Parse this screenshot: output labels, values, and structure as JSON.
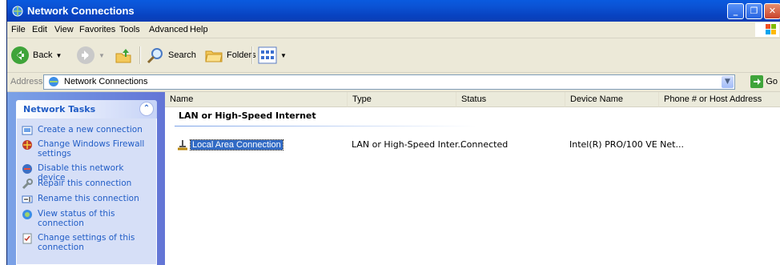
{
  "window": {
    "title": "Network Connections"
  },
  "menu": [
    "File",
    "Edit",
    "View",
    "Favorites",
    "Tools",
    "Advanced",
    "Help"
  ],
  "toolbar": {
    "back": "Back",
    "search": "Search",
    "folders": "Folders"
  },
  "address": {
    "label": "Address",
    "value": "Network Connections",
    "go": "Go"
  },
  "tasks": {
    "title": "Network Tasks",
    "items": [
      {
        "label": "Create a new connection",
        "icon": "new-connection-icon"
      },
      {
        "label": "Change Windows Firewall settings",
        "icon": "firewall-icon"
      },
      {
        "label": "Disable this network device",
        "icon": "disable-device-icon"
      },
      {
        "label": "Repair this connection",
        "icon": "repair-icon"
      },
      {
        "label": "Rename this connection",
        "icon": "rename-icon"
      },
      {
        "label": "View status of this connection",
        "icon": "status-icon"
      },
      {
        "label": "Change settings of this connection",
        "icon": "settings-icon"
      }
    ]
  },
  "list": {
    "columns": [
      "Name",
      "Type",
      "Status",
      "Device Name",
      "Phone # or Host Address"
    ],
    "group": "LAN or High-Speed Internet",
    "rows": [
      {
        "name": "Local Area Connection",
        "type": "LAN or High-Speed Inter...",
        "status": "Connected",
        "device": "Intel(R) PRO/100 VE Net...",
        "host": ""
      }
    ]
  },
  "colors": {
    "titlebar": "#0a53d4",
    "taskpane": "#6f8fde",
    "selection": "#316ac5",
    "link": "#215dc6"
  }
}
